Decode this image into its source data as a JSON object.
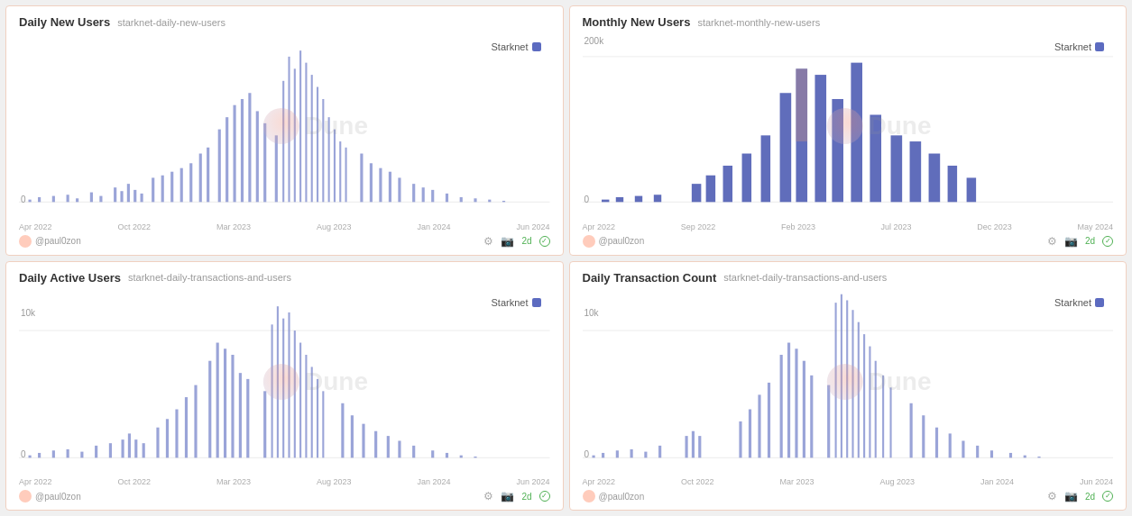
{
  "charts": [
    {
      "id": "daily-new-users",
      "title": "Daily New Users",
      "subtitle": "starknet-daily-new-users",
      "legend": "Starknet",
      "author": "@paul0zon",
      "badge": "2d",
      "y_labels": [
        "0"
      ],
      "x_labels": [
        "Apr 2022",
        "Oct 2022",
        "Mar 2023",
        "Aug 2023",
        "Jan 2024",
        "Jun 2024"
      ],
      "type": "daily-spike"
    },
    {
      "id": "monthly-new-users",
      "title": "Monthly New Users",
      "subtitle": "starknet-monthly-new-users",
      "legend": "Starknet",
      "author": "@paul0zon",
      "badge": "2d",
      "y_labels": [
        "200k",
        "0"
      ],
      "x_labels": [
        "Apr 2022",
        "Sep 2022",
        "Feb 2023",
        "Jul 2023",
        "Dec 2023",
        "May 2024"
      ],
      "type": "monthly-bar"
    },
    {
      "id": "daily-active-users",
      "title": "Daily Active Users",
      "subtitle": "starknet-daily-transactions-and-users",
      "legend": "Starknet",
      "author": "@paul0zon",
      "badge": "2d",
      "y_labels": [
        "10k",
        "0"
      ],
      "x_labels": [
        "Apr 2022",
        "Oct 2022",
        "Mar 2023",
        "Aug 2023",
        "Jan 2024",
        "Jun 2024"
      ],
      "type": "daily-active"
    },
    {
      "id": "daily-transaction-count",
      "title": "Daily Transaction Count",
      "subtitle": "starknet-daily-transactions-and-users",
      "legend": "Starknet",
      "author": "@paul0zon",
      "badge": "2d",
      "y_labels": [
        "10k",
        "0"
      ],
      "x_labels": [
        "Apr 2022",
        "Oct 2022",
        "Mar 2023",
        "Aug 2023",
        "Jan 2024",
        "Jun 2024"
      ],
      "type": "daily-tx"
    }
  ]
}
